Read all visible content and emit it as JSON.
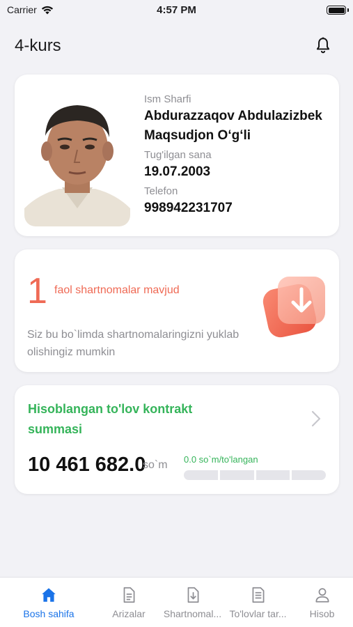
{
  "status_bar": {
    "carrier": "Carrier",
    "time": "4:57 PM"
  },
  "header": {
    "title": "4-kurs"
  },
  "profile": {
    "name_label": "Ism Sharfi",
    "name_line1": "Abdurazzaqov Abdulazizbek",
    "name_line2": "Maqsudjon O‘g‘li",
    "birth_label": "Tug'ilgan sana",
    "birth_date": "19.07.2003",
    "phone_label": "Telefon",
    "phone": "998942231707"
  },
  "contracts": {
    "count": "1",
    "count_label": "faol shartnomalar mavjud",
    "description": "Siz bu bo`limda shartnomalaringizni yuklab olishingiz mumkin"
  },
  "payment": {
    "title": "Hisoblangan to'lov kontrakt summasi",
    "amount": "10 461 682.0",
    "currency": "so`m",
    "paid_label": "0.0 so`m/to'langan",
    "paid_fraction": 0
  },
  "tabs": [
    {
      "label": "Bosh sahifa",
      "icon": "home-icon",
      "active": true
    },
    {
      "label": "Arizalar",
      "icon": "document-icon",
      "active": false
    },
    {
      "label": "Shartnomal...",
      "icon": "download-document-icon",
      "active": false
    },
    {
      "label": "To'lovlar tar...",
      "icon": "list-document-icon",
      "active": false
    },
    {
      "label": "Hisob",
      "icon": "user-icon",
      "active": false
    }
  ],
  "colors": {
    "accent_green": "#35b45a",
    "accent_coral": "#ef6a55",
    "tab_active": "#1a73e8",
    "background": "#f2f2f6"
  }
}
